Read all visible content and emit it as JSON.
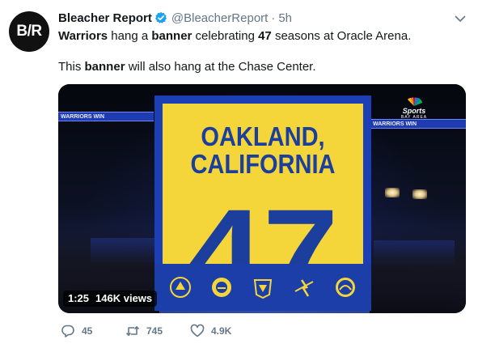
{
  "author": {
    "display_name": "Bleacher Report",
    "handle": "@BleacherReport",
    "separator": "·",
    "time": "5h",
    "avatar_text": "B/R",
    "verified_color": "#1da1f2"
  },
  "tweet": {
    "line1": [
      {
        "text": "Warriors",
        "bold": true
      },
      {
        "text": " hang a ",
        "bold": false
      },
      {
        "text": "banner",
        "bold": true
      },
      {
        "text": " celebrating ",
        "bold": false
      },
      {
        "text": "47",
        "bold": true
      },
      {
        "text": " seasons at Oracle Arena.",
        "bold": false
      }
    ],
    "line2": [
      {
        "text": "This ",
        "bold": false
      },
      {
        "text": "banner",
        "bold": true
      },
      {
        "text": " will also hang at the Chase Center.",
        "bold": false
      }
    ]
  },
  "media": {
    "type": "video",
    "duration": "1:25",
    "views": "146K views",
    "banner_title_line1": "OAKLAND,",
    "banner_title_line2": "CALIFORNIA",
    "banner_number": "47",
    "ribbon_left": "WARRIORS WIN",
    "ribbon_right": "WARRIORS WIN",
    "network_logo": "Sports",
    "network_sub": "BAY AREA",
    "banner_color": "#f4d63a",
    "banner_text_color": "#1c3f9e",
    "banner_border_color": "#1d3fb6"
  },
  "actions": {
    "replies": "45",
    "retweets": "745",
    "likes": "4.9K"
  },
  "colors": {
    "text": "#14171a",
    "secondary": "#657786",
    "accent": "#1da1f2"
  }
}
